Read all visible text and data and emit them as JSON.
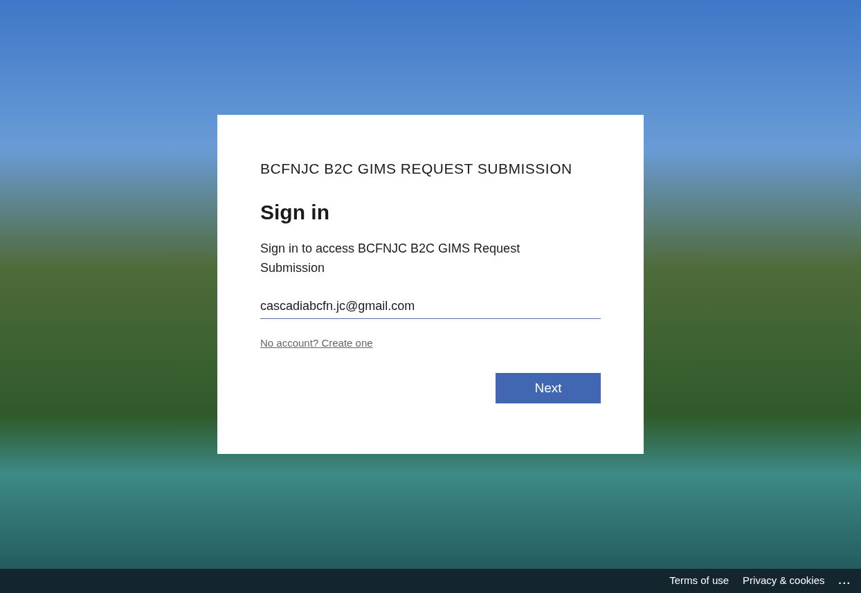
{
  "card": {
    "brand": "BCFNJC B2C GIMS REQUEST SUBMISSION",
    "title": "Sign in",
    "description": "Sign in to access BCFNJC B2C GIMS Request Submission",
    "email_field": {
      "value": "cascadiabcfn.jc@gmail.com"
    },
    "create_account_link": "No account? Create one",
    "next_button": "Next"
  },
  "footer": {
    "links": [
      "Terms of use",
      "Privacy & cookies"
    ],
    "more": "..."
  }
}
